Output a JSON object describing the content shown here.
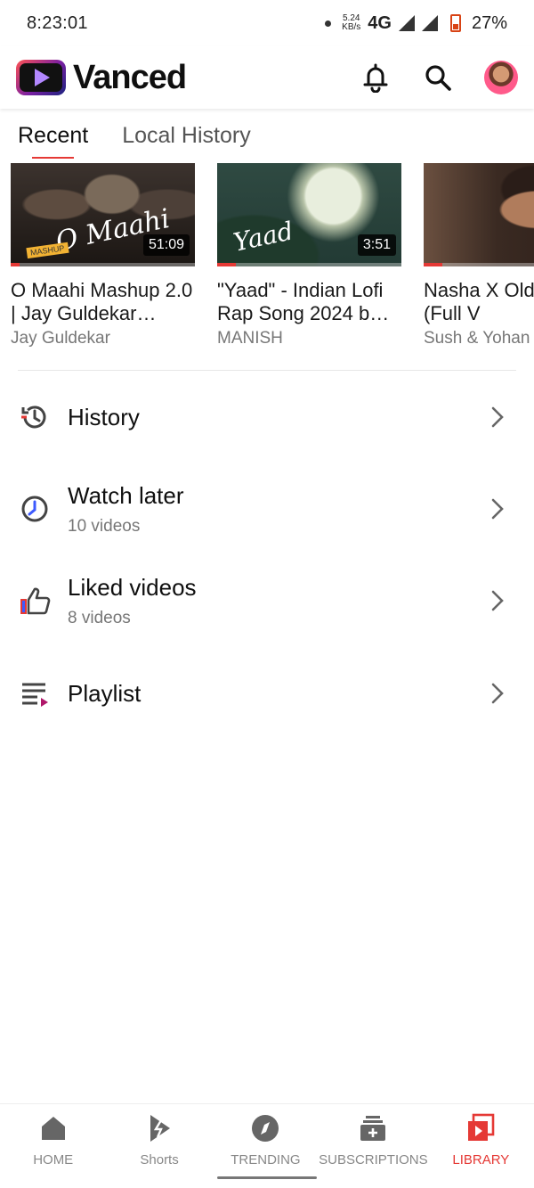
{
  "status_bar": {
    "time": "8:23:01",
    "net_speed_value": "5.24",
    "net_speed_unit": "KB/s",
    "network": "4G",
    "battery": "27%"
  },
  "header": {
    "app_name": "Vanced",
    "icons": [
      "bell-icon",
      "search-icon",
      "avatar"
    ]
  },
  "tabs": [
    {
      "label": "Recent",
      "active": true
    },
    {
      "label": "Local History",
      "active": false
    }
  ],
  "recent_videos": [
    {
      "title": "O Maahi Mashup 2.0 | Jay Guldekar…",
      "channel": "Jay Guldekar",
      "duration": "51:09",
      "thumb_text": "O Maahi",
      "thumb_badge": "MASHUP",
      "progress": 0.05
    },
    {
      "title": "\"Yaad\" - Indian Lofi Rap Song 2024 b…",
      "channel": "MANISH",
      "duration": "3:51",
      "thumb_text": "Yaad",
      "progress": 0.1
    },
    {
      "title": "Nasha X Old Road (Full V",
      "channel": "Sush & Yohan",
      "duration": "",
      "progress": 0.1
    }
  ],
  "library": {
    "history": {
      "label": "History"
    },
    "watch_later": {
      "label": "Watch later",
      "sub": "10 videos"
    },
    "liked": {
      "label": "Liked videos",
      "sub": "8 videos"
    },
    "playlist": {
      "label": "Playlist"
    }
  },
  "bottom_nav": [
    {
      "label": "HOME",
      "icon": "home-icon",
      "active": false
    },
    {
      "label": "Shorts",
      "icon": "shorts-icon",
      "active": false
    },
    {
      "label": "TRENDING",
      "icon": "trending-icon",
      "active": false
    },
    {
      "label": "SUBSCRIPTIONS",
      "icon": "subscriptions-icon",
      "active": false
    },
    {
      "label": "LIBRARY",
      "icon": "library-icon",
      "active": true
    }
  ],
  "colors": {
    "accent": "#e53935",
    "text_primary": "#0f0f0f",
    "text_secondary": "#777777"
  }
}
